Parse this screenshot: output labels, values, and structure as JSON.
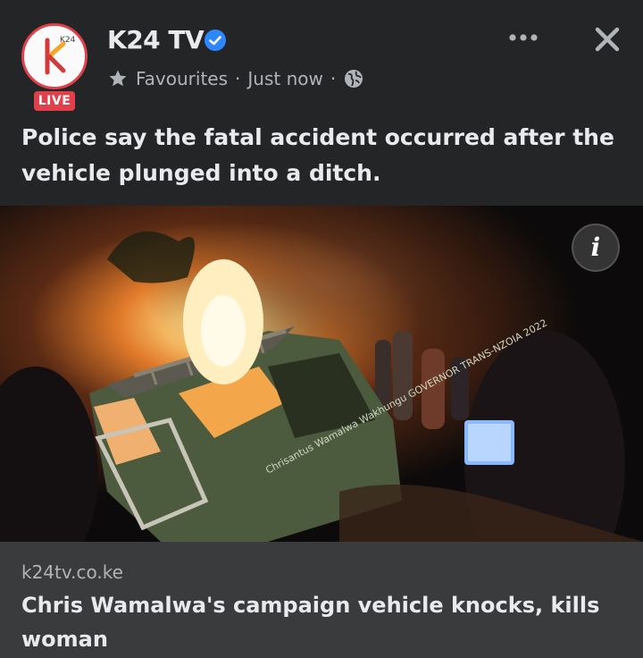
{
  "post": {
    "page_name": "K24 TV",
    "verified_icon": "verified-badge-icon",
    "live_badge": "LIVE",
    "avatar_logo_text": "K24",
    "audience_label": "Favourites",
    "audience_icon": "star-icon",
    "separator": "·",
    "timestamp": "Just now",
    "privacy_icon": "globe-icon",
    "more_icon": "more-options-icon",
    "close_icon": "close-icon",
    "caption": "Police say the fatal accident occurred after the vehicle plunged into a ditch."
  },
  "media": {
    "info_label": "i",
    "vehicle_text": "Chrisantus Wamalwa Wakhungu GOVERNOR TRANS-NZOIA 2022"
  },
  "link_preview": {
    "domain": "k24tv.co.ke",
    "title": "Chris Wamalwa's campaign vehicle knocks, kills woman"
  },
  "colors": {
    "background": "#242526",
    "card": "#3a3b3c",
    "accent_live": "#e0404a",
    "verified": "#2d88ff",
    "text_primary": "#e9eaed",
    "text_secondary": "#b0b3b8"
  }
}
